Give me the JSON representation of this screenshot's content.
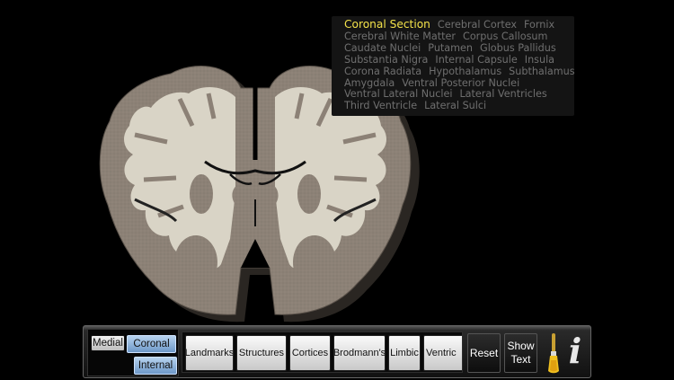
{
  "legend": {
    "lines": [
      [
        "Coronal Section",
        "Cerebral Cortex",
        "Fornix"
      ],
      [
        "Cerebral White Matter",
        "Corpus Callosum"
      ],
      [
        "Caudate Nuclei",
        "Putamen",
        "Globus Pallidus"
      ],
      [
        "Substantia Nigra",
        "Internal Capsule",
        "Insula"
      ],
      [
        "Corona Radiata",
        "Hypothalamus",
        "Subthalamus"
      ],
      [
        "Amygdala",
        "Ventral Posterior Nuclei"
      ],
      [
        "Ventral Lateral Nuclei",
        "Lateral Ventricles"
      ],
      [
        "Third Ventricle",
        "Lateral Sulci"
      ]
    ],
    "title_color": "#f3e24a",
    "item_color": "#6f6f6f"
  },
  "toolbar": {
    "views": {
      "medial": "Medial",
      "coronal": "Coronal",
      "internal": "Internal",
      "selected": "Coronal"
    },
    "tabs": [
      "Landmarks",
      "Structures",
      "Cortices",
      "Brodmann's",
      "Limbic",
      "Ventric"
    ],
    "reset": "Reset",
    "show_text_line1": "Show",
    "show_text_line2": "Text",
    "info": "i"
  },
  "colors": {
    "cortex_grey": "#8c8176",
    "white_matter": "#d9d4c6",
    "background": "#000000",
    "selected_button": "#7ea6d2"
  },
  "icons": {
    "brush": "paint-brush-icon",
    "info": "info-icon"
  }
}
